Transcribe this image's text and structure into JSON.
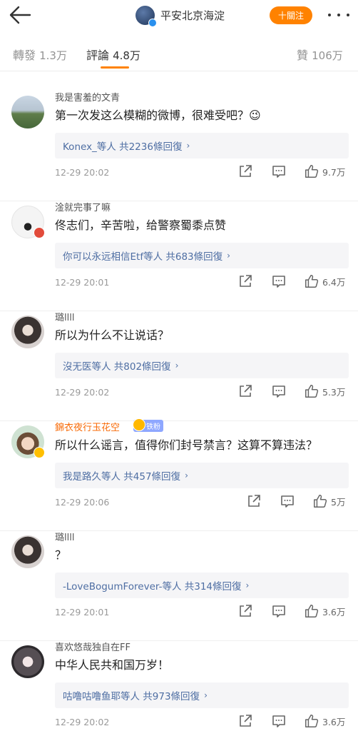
{
  "header": {
    "title": "平安北京海淀",
    "follow_label": "十關注",
    "colors": {
      "accent": "#ff8200"
    }
  },
  "tabs": [
    {
      "label": "轉發",
      "count": "1.3万"
    },
    {
      "label": "評論",
      "count": "4.8万"
    },
    {
      "label": "贊",
      "count": "106万"
    }
  ],
  "comments": [
    {
      "user": "我是害羞的文青",
      "text": "第一次发这么模糊的微博，很难受吧？",
      "emoji": "😉",
      "replies": "Konex_等人 共2236條回復",
      "time": "12-29 20:02",
      "likes": "9.7万"
    },
    {
      "user": "淦就完事了嘛",
      "text": "佟志们，辛苦啦，给警察蜀黍点赞",
      "replies": "你可以永远相信Etf等人 共683條回復",
      "time": "12-29 20:01",
      "likes": "6.4万"
    },
    {
      "user": "璐llll",
      "text": "所以为什么不让说话？",
      "replies": "沒无医等人 共802條回復",
      "time": "12-29 20:02",
      "likes": "5.3万"
    },
    {
      "user": "錦衣夜行玉花空",
      "badge": "铁粉",
      "text": "所以什么谣言，值得你们封号禁言？这算不算违法？",
      "replies": "我是路久等人 共457條回復",
      "time": "12-29 20:06",
      "likes": "5万"
    },
    {
      "user": "璐llll",
      "text": "？",
      "replies": "-LoveBogumForever-等人 共314條回復",
      "time": "12-29 20:01",
      "likes": "3.6万"
    },
    {
      "user": "喜欢悠哉独自在FF",
      "text": "中华人民共和国万岁！",
      "replies": "咕噜咕噜鱼耶等人 共973條回復",
      "time": "12-29 20:02",
      "likes": "3.6万"
    }
  ]
}
